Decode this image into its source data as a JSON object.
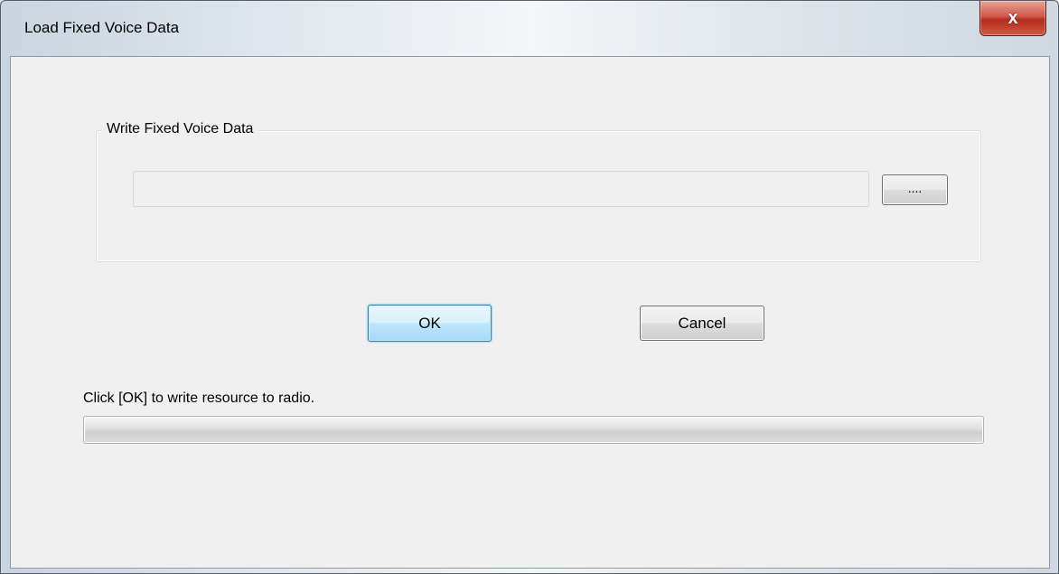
{
  "window": {
    "title": "Load Fixed Voice Data",
    "close_label": "x"
  },
  "group": {
    "label": "Write Fixed Voice Data",
    "path_value": "",
    "browse_label": "...."
  },
  "buttons": {
    "ok_label": "OK",
    "cancel_label": "Cancel"
  },
  "status": {
    "text": "Click [OK] to write resource to radio.",
    "progress": 0
  },
  "colors": {
    "ok_border": "#3c7fb1",
    "close_red": "#b52c1d"
  },
  "icons": {
    "close": "close-icon"
  }
}
